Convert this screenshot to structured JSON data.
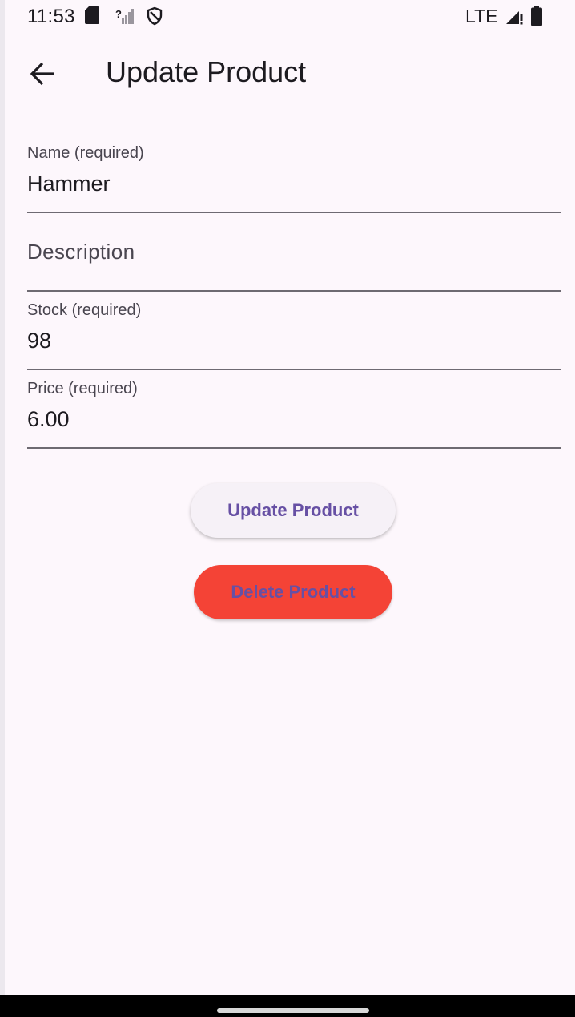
{
  "status_bar": {
    "time": "11:53",
    "network": "LTE",
    "icons": [
      "sd-card-icon",
      "no-signal-icon",
      "shield-icon",
      "signal-icon",
      "battery-icon"
    ]
  },
  "app_bar": {
    "back_icon": "arrow-left-icon",
    "title": "Update Product"
  },
  "form": {
    "name": {
      "label": "Name (required)",
      "value": "Hammer"
    },
    "description": {
      "placeholder": "Description",
      "value": ""
    },
    "stock": {
      "label": "Stock (required)",
      "value": "98"
    },
    "price": {
      "label": "Price (required)",
      "value": "6.00"
    }
  },
  "actions": {
    "update_label": "Update Product",
    "delete_label": "Delete Product"
  },
  "colors": {
    "background": "#fdf7fc",
    "primary": "#6750a4",
    "danger": "#f44336",
    "update_button_bg": "#f6f1f7"
  }
}
